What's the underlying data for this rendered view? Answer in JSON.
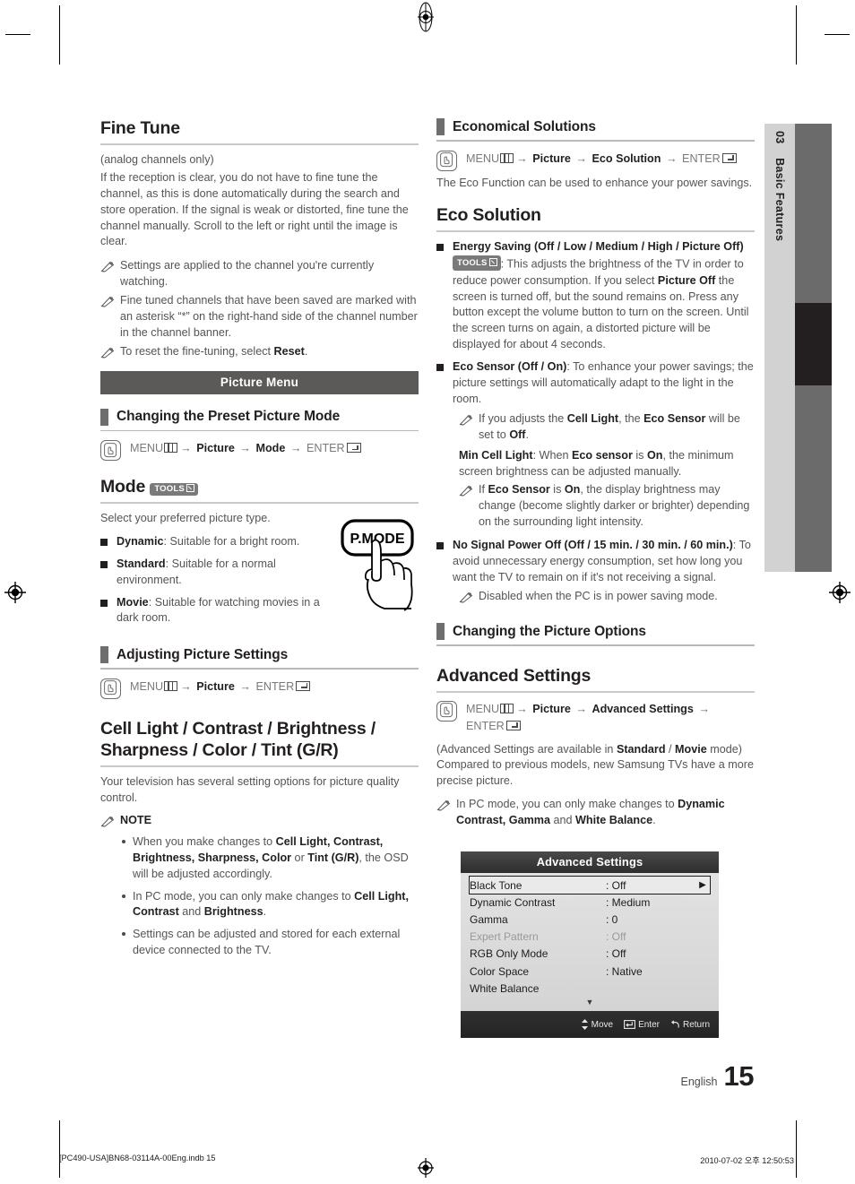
{
  "sidetab": {
    "chapter_number": "03",
    "chapter_title": "Basic Features"
  },
  "page_footer": {
    "language": "English",
    "page_number": "15",
    "print_file": "[PC490-USA]BN68-03114A-00Eng.indb   15",
    "print_timestamp": "2010-07-02   오후 12:50:53"
  },
  "left_column": {
    "fine_tune": {
      "title": "Fine Tune",
      "subtitle": "(analog channels only)",
      "body": "If the reception is clear, you do not have to fine tune the channel, as this is done automatically during the search and store operation. If the signal is weak or distorted, fine tune the channel manually. Scroll to the left or right until the image is clear.",
      "notes": [
        "Settings are applied to the channel you're currently watching.",
        "Fine tuned channels that have been saved are marked with an asterisk “*” on the right-hand side of the channel number in the channel banner.",
        "To reset the fine-tuning, select Reset."
      ],
      "note3_prefix": "To reset the fine-tuning, select ",
      "note3_bold": "Reset",
      "note3_suffix": "."
    },
    "banner": "Picture Menu",
    "preset_mode_section": {
      "heading": "Changing the Preset Picture Mode",
      "path": {
        "menu": "MENU",
        "step2": "Picture",
        "step3": "Mode",
        "enter": "ENTER"
      }
    },
    "mode": {
      "title": "Mode",
      "tools_badge": "TOOLS",
      "intro": "Select your preferred picture type.",
      "items": [
        {
          "name": "Dynamic",
          "desc": ": Suitable for a bright room."
        },
        {
          "name": "Standard",
          "desc": ": Suitable for a normal environment."
        },
        {
          "name": "Movie",
          "desc": ": Suitable for watching movies in a dark room."
        }
      ],
      "remote_button_label": "P.MODE"
    },
    "adjusting_section": {
      "heading": "Adjusting Picture Settings",
      "path": {
        "menu": "MENU",
        "step2": "Picture",
        "enter": "ENTER"
      }
    },
    "cell_light": {
      "title": "Cell Light / Contrast / Brightness / Sharpness / Color / Tint (G/R)",
      "body": "Your television has several setting options for picture quality control.",
      "note_label": "NOTE",
      "bullets": [
        {
          "parts": [
            {
              "t": "When you make changes to ",
              "b": false
            },
            {
              "t": "Cell Light, Contrast, Brightness, Sharpness, Color",
              "b": true
            },
            {
              "t": " or ",
              "b": false
            },
            {
              "t": "Tint (G/R)",
              "b": true
            },
            {
              "t": ", the OSD will be adjusted accordingly.",
              "b": false
            }
          ]
        },
        {
          "parts": [
            {
              "t": "In PC mode, you can only make changes to ",
              "b": false
            },
            {
              "t": "Cell Light, Contrast",
              "b": true
            },
            {
              "t": " and ",
              "b": false
            },
            {
              "t": "Brightness",
              "b": true
            },
            {
              "t": ".",
              "b": false
            }
          ]
        },
        {
          "parts": [
            {
              "t": "Settings can be adjusted and stored for each external device connected to the TV.",
              "b": false
            }
          ]
        }
      ]
    }
  },
  "right_column": {
    "economical_section": {
      "heading": "Economical Solutions",
      "path": {
        "menu": "MENU",
        "step2": "Picture",
        "step3": "Eco Solution",
        "enter": "ENTER"
      },
      "body": "The Eco Function can be used to enhance your power savings."
    },
    "eco_solution": {
      "title": "Eco Solution",
      "energy_saving": {
        "label": "Energy Saving (Off / Low / Medium / High / Picture Off)",
        "tools_badge": "TOOLS",
        "text_a": ": This adjusts the brightness of the TV in order to reduce power consumption. If you select ",
        "bold_b": "Picture Off",
        "text_c": " the screen is turned off, but the sound remains on. Press any button except the volume button to turn on the screen. Until the screen turns on again, a distorted picture will be displayed for about 4 seconds."
      },
      "eco_sensor": {
        "label": "Eco Sensor (Off / On)",
        "text": ": To enhance your power savings; the picture settings will automatically adapt to the light in the room.",
        "note": {
          "a": "If you adjusts the ",
          "b1": "Cell Light",
          "c": ", the ",
          "b2": "Eco Sensor",
          "d": " will be set to ",
          "b3": "Off",
          "e": "."
        },
        "min_cell_light": {
          "b1": "Min Cell Light",
          "a": ": When ",
          "b2": "Eco sensor",
          "b": " is ",
          "b3": "On",
          "c": ", the minimum screen brightness can be adjusted manually."
        },
        "note2": {
          "a": "If ",
          "b1": "Eco Sensor",
          "b": " is ",
          "b2": "On",
          "c": ", the display brightness may change (become slightly darker or brighter) depending on the surrounding light intensity."
        }
      },
      "no_signal": {
        "label": "No Signal Power Off (Off / 15 min. / 30 min. / 60 min.)",
        "text": ": To avoid unnecessary energy consumption, set how long you want the TV to remain on if it's not receiving a signal.",
        "note": "Disabled when the PC is in power saving mode."
      }
    },
    "picture_options_section": {
      "heading": "Changing the Picture Options"
    },
    "advanced_settings": {
      "title": "Advanced Settings",
      "path": {
        "menu": "MENU",
        "step2": "Picture",
        "step3": "Advanced Settings",
        "enter": "ENTER"
      },
      "body_a": "(Advanced Settings are available in ",
      "body_b1": "Standard",
      "body_mid": " / ",
      "body_b2": "Movie",
      "body_c": " mode) Compared to previous models, new Samsung TVs have a more precise picture.",
      "note": {
        "a": "In PC mode, you can only make changes to ",
        "b1": "Dynamic Contrast, Gamma",
        "b": " and ",
        "b2": "White Balance",
        "c": "."
      }
    },
    "osd": {
      "title": "Advanced Settings",
      "rows": [
        {
          "name": "Black Tone",
          "value": ": Off",
          "selected": true,
          "dimmed": false,
          "arrow": "▶"
        },
        {
          "name": "Dynamic Contrast",
          "value": ": Medium",
          "selected": false,
          "dimmed": false,
          "arrow": ""
        },
        {
          "name": "Gamma",
          "value": ": 0",
          "selected": false,
          "dimmed": false,
          "arrow": ""
        },
        {
          "name": "Expert Pattern",
          "value": ": Off",
          "selected": false,
          "dimmed": true,
          "arrow": ""
        },
        {
          "name": "RGB Only Mode",
          "value": ": Off",
          "selected": false,
          "dimmed": false,
          "arrow": ""
        },
        {
          "name": "Color Space",
          "value": ": Native",
          "selected": false,
          "dimmed": false,
          "arrow": ""
        },
        {
          "name": "White Balance",
          "value": "",
          "selected": false,
          "dimmed": false,
          "arrow": ""
        }
      ],
      "scroll_down_glyph": "▼",
      "footer": {
        "move": "Move",
        "enter": "Enter",
        "return": "Return"
      }
    }
  }
}
